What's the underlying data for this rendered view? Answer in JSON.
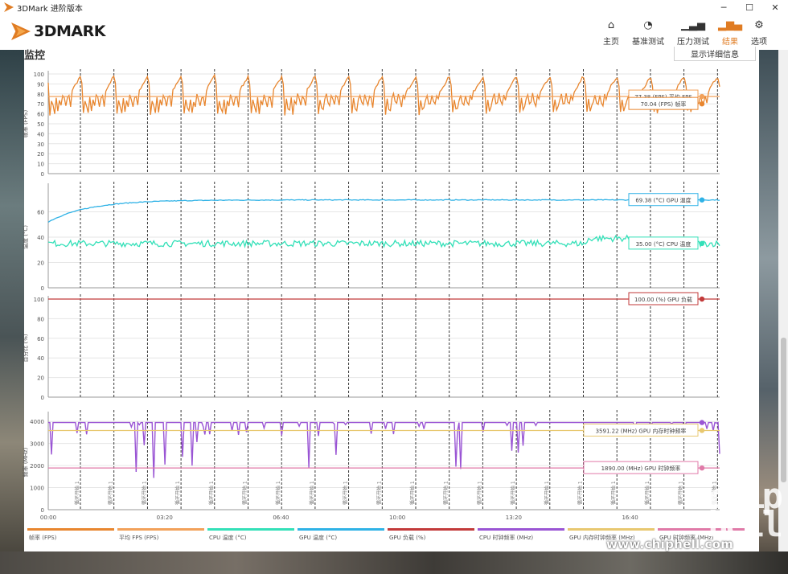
{
  "window": {
    "title": "3DMark 进阶版本",
    "min": "─",
    "max": "☐",
    "close": "✕"
  },
  "logo": {
    "word": "3DMARK"
  },
  "nav": [
    {
      "label": "主页",
      "icon": "home-icon",
      "glyph": "⌂"
    },
    {
      "label": "基准测试",
      "icon": "gauge-icon",
      "glyph": "◔"
    },
    {
      "label": "压力测试",
      "icon": "bar-chart-icon",
      "glyph": "▁▃▅"
    },
    {
      "label": "结果",
      "icon": "results-icon",
      "glyph": "▂▆▄",
      "active": true
    },
    {
      "label": "选项",
      "icon": "gear-icon",
      "glyph": "⚙"
    }
  ],
  "section_title": "监控",
  "detail_button": "显示详细信息",
  "colors": {
    "fps": "#e8862f",
    "avg_fps": "#f2a15a",
    "cpu_temp": "#33e0b8",
    "gpu_temp": "#2fb2e6",
    "gpu_load": "#c23a3a",
    "cpu_clock": "#9a55d4",
    "gpu_mem_clock": "#e8c870",
    "gpu_clock": "#e07aa8"
  },
  "chart_data": {
    "type": "line",
    "x_ticks": [
      "00:00",
      "03:20",
      "06:40",
      "10:00",
      "13:20",
      "16:40"
    ],
    "x_range_seconds": [
      0,
      1200
    ],
    "marker_label": "循环开始 1",
    "marker_count": 20,
    "panels": [
      {
        "ylabel": "帧率 (FPS)",
        "yticks": [
          "100",
          "90",
          "80",
          "70",
          "60",
          "50",
          "40",
          "30",
          "20",
          "10",
          "0"
        ],
        "ylim": [
          0,
          100
        ],
        "series": [
          {
            "name": "帧率 (FPS)",
            "pattern": "sawtooth",
            "low": 63,
            "high": 98
          },
          {
            "name": "平均 FPS (FPS)",
            "pattern": "flat",
            "value": 77.38
          }
        ],
        "callouts": [
          {
            "text": "77.38 (FPS) 平均 FPS",
            "value": 77.38,
            "color_key": "avg_fps"
          },
          {
            "text": "70.04 (FPS) 帧率",
            "value": 70.04,
            "color_key": "fps"
          }
        ]
      },
      {
        "ylabel": "温度 (°C)",
        "yticks": [
          "60",
          "40",
          "20",
          "0"
        ],
        "ylim": [
          0,
          80
        ],
        "series": [
          {
            "name": "GPU 温度 (°C)",
            "pattern": "rise",
            "start": 52,
            "value": 69.4
          },
          {
            "name": "CPU 温度 (°C)",
            "pattern": "noisy",
            "value": 35
          }
        ],
        "callouts": [
          {
            "text": "69.38 (°C) GPU 温度",
            "value": 69.38,
            "color_key": "gpu_temp"
          },
          {
            "text": "35.00 (°C) CPU 温度",
            "value": 35.0,
            "color_key": "cpu_temp"
          }
        ]
      },
      {
        "ylabel": "百分比 (%)",
        "yticks": [
          "100",
          "80",
          "60",
          "40",
          "20",
          "0"
        ],
        "ylim": [
          0,
          100
        ],
        "series": [
          {
            "name": "GPU 负载 (%)",
            "pattern": "flat",
            "value": 100
          }
        ],
        "callouts": [
          {
            "text": "100.00 (%) GPU 负载",
            "value": 100.0,
            "color_key": "gpu_load"
          }
        ]
      },
      {
        "ylabel": "频率 (MHz)",
        "yticks": [
          "4000",
          "3000",
          "2000",
          "1000",
          "0"
        ],
        "ylim": [
          0,
          4300
        ],
        "series": [
          {
            "name": "CPU 时钟频率 (MHz)",
            "pattern": "spiky",
            "value": 3950
          },
          {
            "name": "GPU 内存时钟频率 (MHz)",
            "pattern": "flat",
            "value": 3591.22
          },
          {
            "name": "GPU 时钟频率 (MHz)",
            "pattern": "flat",
            "value": 1890
          }
        ],
        "callouts": [
          {
            "text": "3591.22 (MHz) GPU 内存时钟频率",
            "value": 3591.22,
            "color_key": "gpu_mem_clock"
          },
          {
            "text": "1890.00 (MHz) GPU 时钟频率",
            "value": 1890.0,
            "color_key": "gpu_clock"
          }
        ]
      }
    ],
    "legend": [
      {
        "label": "帧率 (FPS)",
        "color_key": "fps"
      },
      {
        "label": "平均 FPS (FPS)",
        "color_key": "avg_fps"
      },
      {
        "label": "CPU 温度 (°C)",
        "color_key": "cpu_temp"
      },
      {
        "label": "GPU 温度 (°C)",
        "color_key": "gpu_temp"
      },
      {
        "label": "GPU 负载 (%)",
        "color_key": "gpu_load"
      },
      {
        "label": "CPU 时钟频率 (MHz)",
        "color_key": "cpu_clock"
      },
      {
        "label": "GPU 内存时钟频率 (MHz)",
        "color_key": "gpu_mem_clock"
      },
      {
        "label": "GPU 时钟频率 (MHz)",
        "color_key": "gpu_clock"
      }
    ]
  },
  "watermark": {
    "site": "www.chiphell.com",
    "logo_text": "chip hell"
  }
}
